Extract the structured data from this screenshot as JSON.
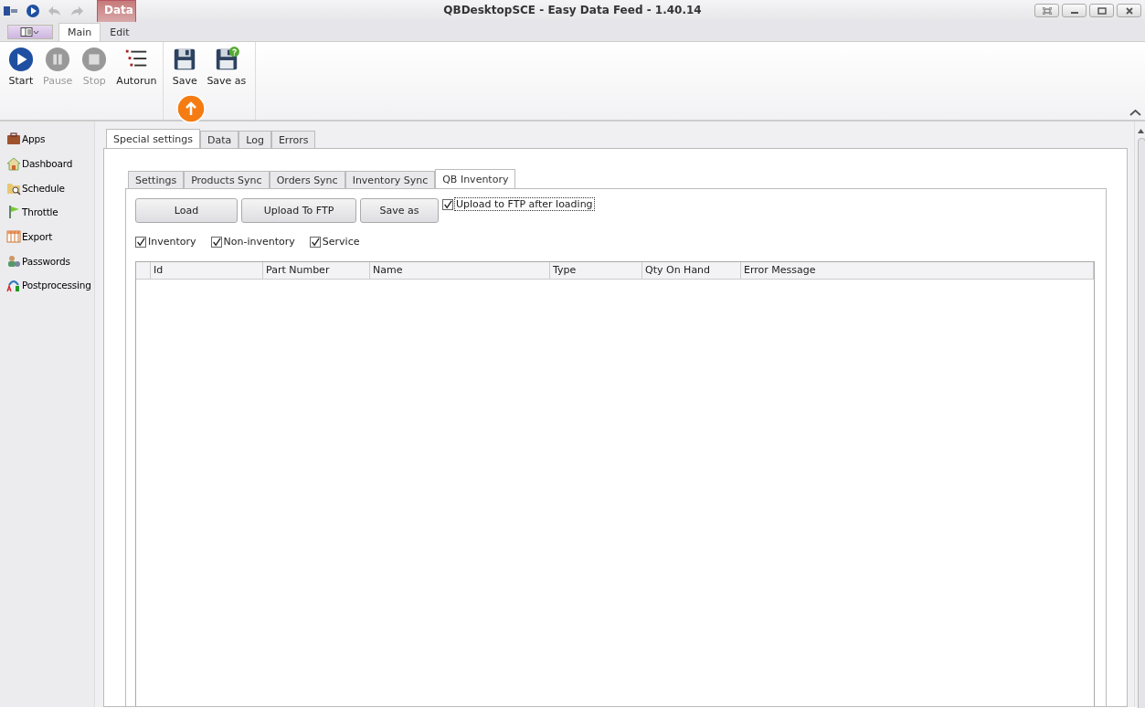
{
  "window": {
    "title": "QBDesktopSCE - Easy Data Feed - 1.40.14"
  },
  "ribbon": {
    "context_group": "Data",
    "tabs": [
      {
        "label": "Main",
        "selected": true
      },
      {
        "label": "Edit",
        "selected": false
      }
    ],
    "buttons": [
      {
        "label": "Start",
        "kind": "play",
        "disabled": false
      },
      {
        "label": "Pause",
        "kind": "pause",
        "disabled": true
      },
      {
        "label": "Stop",
        "kind": "stop",
        "disabled": true
      },
      {
        "label": "Autorun",
        "kind": "list",
        "disabled": false
      },
      {
        "label": "Save",
        "kind": "save",
        "disabled": false
      },
      {
        "label": "Save as",
        "kind": "saveas",
        "disabled": false
      }
    ]
  },
  "sidebar": {
    "items": [
      {
        "label": "Apps",
        "kind": "briefcase"
      },
      {
        "label": "Dashboard",
        "kind": "home"
      },
      {
        "label": "Schedule",
        "kind": "folder"
      },
      {
        "label": "Throttle",
        "kind": "flag"
      },
      {
        "label": "Export",
        "kind": "table"
      },
      {
        "label": "Passwords",
        "kind": "users"
      },
      {
        "label": "Postprocessing",
        "kind": "ab"
      }
    ]
  },
  "tabs": [
    {
      "label": "Special settings",
      "selected": true
    },
    {
      "label": "Data",
      "selected": false
    },
    {
      "label": "Log",
      "selected": false
    },
    {
      "label": "Errors",
      "selected": false
    }
  ],
  "sub_tabs": [
    {
      "label": "Settings",
      "selected": false
    },
    {
      "label": "Products Sync",
      "selected": false
    },
    {
      "label": "Orders Sync",
      "selected": false
    },
    {
      "label": "Inventory Sync",
      "selected": false
    },
    {
      "label": "QB Inventory",
      "selected": true
    }
  ],
  "actions": [
    "Load",
    "Upload To FTP",
    "Save as"
  ],
  "upload_after_loading": {
    "label": "Upload to FTP after loading",
    "checked": true
  },
  "filters": [
    {
      "label": "Inventory",
      "checked": true
    },
    {
      "label": "Non-inventory",
      "checked": true
    },
    {
      "label": "Service",
      "checked": true
    }
  ],
  "table": {
    "columns": [
      "Id",
      "Part Number",
      "Name",
      "Type",
      "Qty On Hand",
      "Error Message"
    ]
  }
}
